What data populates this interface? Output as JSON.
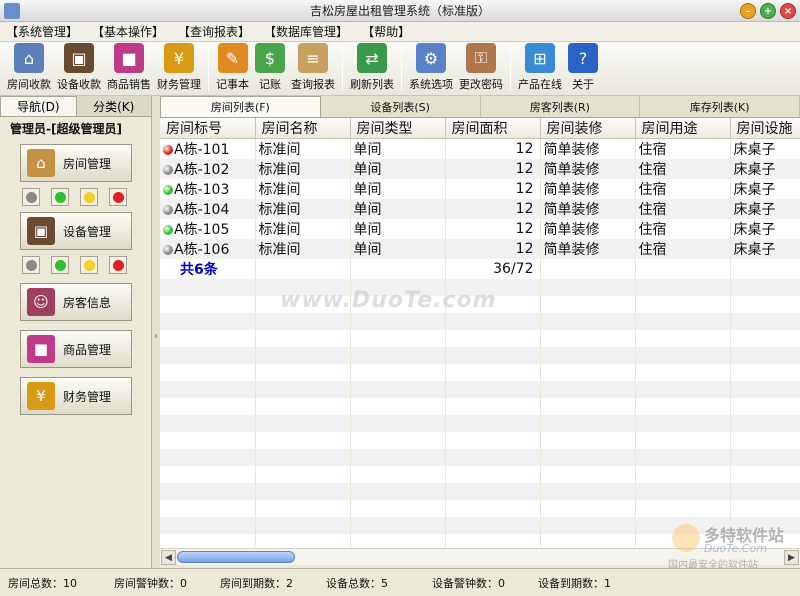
{
  "window": {
    "title": "吉松房屋出租管理系统（标准版）"
  },
  "menu": [
    "【系统管理】",
    "【基本操作】",
    "【查询报表】",
    "【数据库管理】",
    "【帮助】"
  ],
  "toolbar": {
    "groups": [
      [
        {
          "label": "房间收款",
          "icon": "house-icon",
          "color": "#5b7fb8",
          "glyph": "⌂"
        },
        {
          "label": "设备收款",
          "icon": "tv-icon",
          "color": "#6b4a32",
          "glyph": "▣"
        },
        {
          "label": "商品销售",
          "icon": "blocks-icon",
          "color": "#c03a8a",
          "glyph": "■"
        },
        {
          "label": "财务管理",
          "icon": "yuan-icon",
          "color": "#d99a18",
          "glyph": "¥"
        }
      ],
      [
        {
          "label": "记事本",
          "icon": "notebook-icon",
          "color": "#e08a24",
          "glyph": "✎"
        },
        {
          "label": "记账",
          "icon": "money-icon",
          "color": "#4aa54a",
          "glyph": "$"
        },
        {
          "label": "查询报表",
          "icon": "report-icon",
          "color": "#c8a060",
          "glyph": "≡"
        }
      ],
      [
        {
          "label": "刷新列表",
          "icon": "refresh-icon",
          "color": "#3a9a4a",
          "glyph": "⇄"
        }
      ],
      [
        {
          "label": "系统选项",
          "icon": "gear-icon",
          "color": "#5a82c8",
          "glyph": "⚙"
        },
        {
          "label": "更改密码",
          "icon": "key-icon",
          "color": "#b0784a",
          "glyph": "⚿"
        }
      ],
      [
        {
          "label": "产品在线",
          "icon": "windows-icon",
          "color": "#3a8ad8",
          "glyph": "⊞"
        },
        {
          "label": "关于",
          "icon": "help-icon",
          "color": "#2a62c8",
          "glyph": "?"
        }
      ]
    ]
  },
  "left": {
    "tabs": [
      "导航(D)",
      "分类(K)"
    ],
    "admin_label": "管理员-[超级管理员]",
    "nav": [
      {
        "label": "房间管理",
        "icon": "house-icon",
        "color": "#c49244",
        "glyph": "⌂",
        "lights": true
      },
      {
        "label": "设备管理",
        "icon": "tv-icon",
        "color": "#6b4a32",
        "glyph": "▣",
        "lights": true
      },
      {
        "label": "房客信息",
        "icon": "people-icon",
        "color": "#a04060",
        "glyph": "☺",
        "lights": false
      },
      {
        "label": "商品管理",
        "icon": "blocks-icon",
        "color": "#c03a8a",
        "glyph": "■",
        "lights": false
      },
      {
        "label": "财务管理",
        "icon": "yuan-icon",
        "color": "#d99a18",
        "glyph": "¥",
        "lights": false
      }
    ],
    "light_colors": [
      "#8a8a8a",
      "#2ec02e",
      "#f0d020",
      "#e02020"
    ]
  },
  "tabs": [
    "房间列表(F)",
    "设备列表(S)",
    "房客列表(R)",
    "库存列表(K)"
  ],
  "table": {
    "columns": [
      "房间标号",
      "房间名称",
      "房间类型",
      "房间面积",
      "房间装修",
      "房间用途",
      "房间设施"
    ],
    "rows": [
      {
        "status": "#e02020",
        "id": "A栋-101",
        "name": "标准间",
        "type": "单间",
        "area": "12",
        "decor": "简单装修",
        "use": "住宿",
        "facility": "床桌子"
      },
      {
        "status": "#8a8a8a",
        "id": "A栋-102",
        "name": "标准间",
        "type": "单间",
        "area": "12",
        "decor": "简单装修",
        "use": "住宿",
        "facility": "床桌子"
      },
      {
        "status": "#2ec02e",
        "id": "A栋-103",
        "name": "标准间",
        "type": "单间",
        "area": "12",
        "decor": "简单装修",
        "use": "住宿",
        "facility": "床桌子"
      },
      {
        "status": "#8a8a8a",
        "id": "A栋-104",
        "name": "标准间",
        "type": "单间",
        "area": "12",
        "decor": "简单装修",
        "use": "住宿",
        "facility": "床桌子"
      },
      {
        "status": "#2ec02e",
        "id": "A栋-105",
        "name": "标准间",
        "type": "单间",
        "area": "12",
        "decor": "简单装修",
        "use": "住宿",
        "facility": "床桌子"
      },
      {
        "status": "#8a8a8a",
        "id": "A栋-106",
        "name": "标准间",
        "type": "单间",
        "area": "12",
        "decor": "简单装修",
        "use": "住宿",
        "facility": "床桌子"
      }
    ],
    "summary_count": "共6条",
    "summary_area": "36/72"
  },
  "statusbar": [
    "房间总数：10",
    "房间警钟数：0",
    "房间到期数：2",
    "设备总数：5",
    "设备警钟数：0",
    "设备到期数：1"
  ],
  "watermarks": {
    "center": "www.DuoTe.com",
    "logo_title": "多特软件站",
    "logo_url": "DuoTe.Com",
    "logo_slogan": "国内最安全的软件站"
  }
}
